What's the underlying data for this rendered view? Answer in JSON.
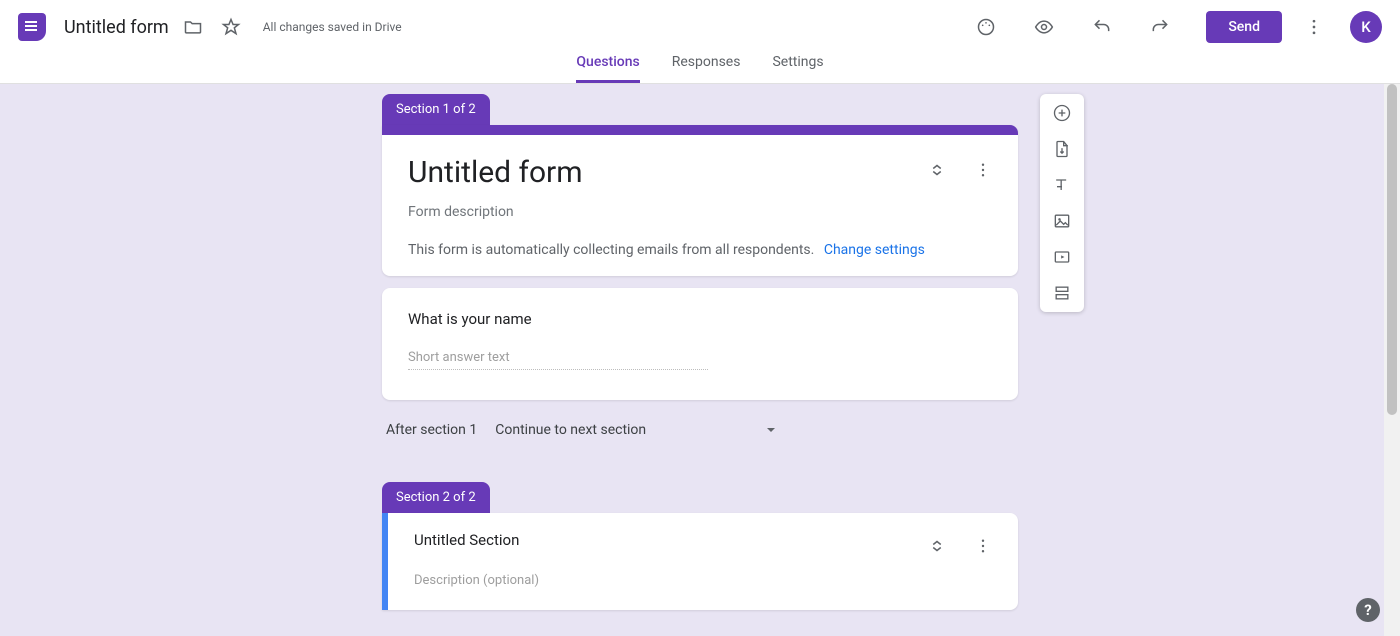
{
  "header": {
    "doc_title": "Untitled form",
    "save_status": "All changes saved in Drive",
    "send_label": "Send",
    "avatar_letter": "K"
  },
  "tabs": {
    "questions": "Questions",
    "responses": "Responses",
    "settings": "Settings"
  },
  "section1": {
    "tag": "Section 1 of 2",
    "form_title": "Untitled form",
    "form_description_placeholder": "Form description",
    "email_note": "This form is automatically collecting emails from all respondents.",
    "change_settings": "Change settings"
  },
  "question1": {
    "title": "What is your name",
    "answer_placeholder": "Short answer text"
  },
  "after_section": {
    "label": "After section 1",
    "selected": "Continue to next section"
  },
  "section2": {
    "tag": "Section 2 of 2",
    "title": "Untitled Section",
    "description_placeholder": "Description (optional)"
  }
}
